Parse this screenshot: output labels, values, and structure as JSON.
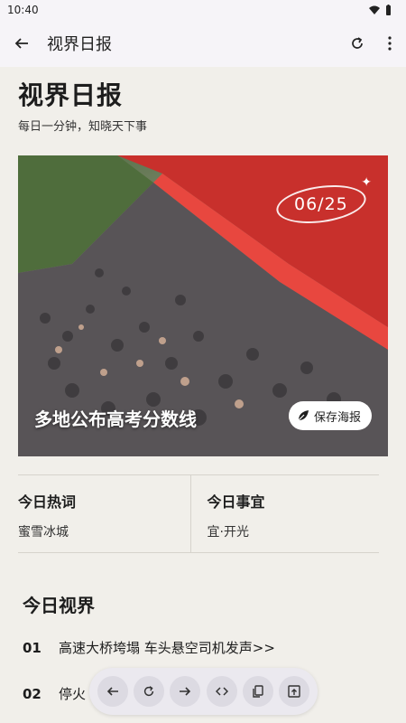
{
  "status": {
    "time": "10:40"
  },
  "appbar": {
    "title": "视界日报"
  },
  "page": {
    "headline": "视界日报",
    "subline": "每日一分钟，知晓天下事",
    "hero": {
      "date": "06/25",
      "caption": "多地公布高考分数线",
      "save_label": "保存海报"
    },
    "info": {
      "hot_label": "今日热词",
      "hot_value": "蜜雪冰城",
      "todo_label": "今日事宜",
      "todo_value": "宜·开光"
    },
    "section_title": "今日视界",
    "news": [
      {
        "num": "01",
        "text": "高速大桥垮塌 车头悬空司机发声>>"
      },
      {
        "num": "02",
        "text": "停火"
      }
    ]
  },
  "icons": {
    "back": "arrow-left-icon",
    "refresh": "refresh-icon",
    "more": "more-vert-icon",
    "wifi": "wifi-icon",
    "battery": "battery-icon",
    "sparkle": "sparkle-icon",
    "leaf": "leaf-icon",
    "toolbar": [
      "arrow-left-icon",
      "refresh-icon",
      "arrow-right-icon",
      "code-icon",
      "copy-icon",
      "open-external-icon"
    ]
  }
}
